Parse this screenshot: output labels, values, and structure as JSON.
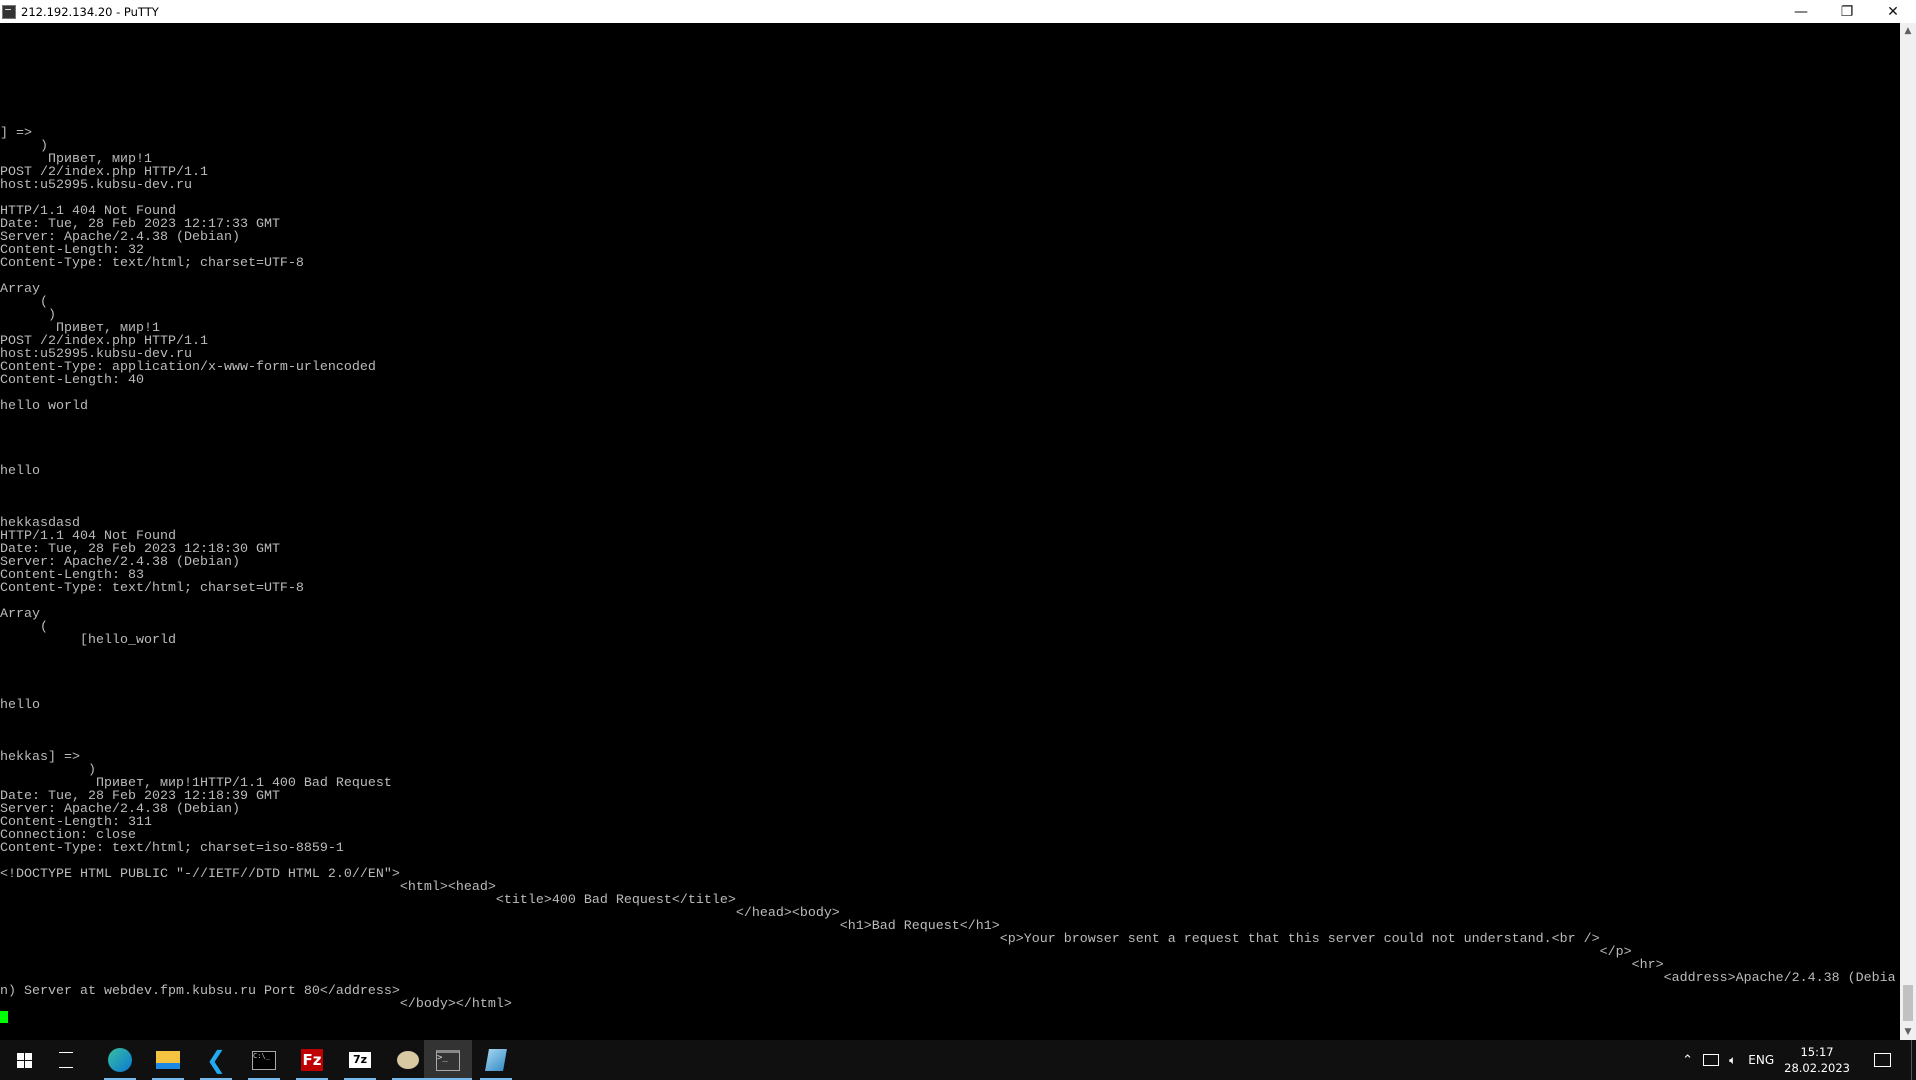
{
  "window": {
    "title": "212.192.134.20 - PuTTY",
    "buttons": {
      "minimize": "—",
      "restore": "❐",
      "close": "✕"
    }
  },
  "terminal": {
    "text_color": "#bbbbbb",
    "cursor_color": "#00ff00",
    "lines": [
      "] =>",
      "     )",
      "      Привет, мир!1",
      "POST /2/index.php HTTP/1.1",
      "host:u52995.kubsu-dev.ru",
      "",
      "HTTP/1.1 404 Not Found",
      "Date: Tue, 28 Feb 2023 12:17:33 GMT",
      "Server: Apache/2.4.38 (Debian)",
      "Content-Length: 32",
      "Content-Type: text/html; charset=UTF-8",
      "",
      "Array",
      "     (",
      "      )",
      "       Привет, мир!1",
      "POST /2/index.php HTTP/1.1",
      "host:u52995.kubsu-dev.ru",
      "Content-Type: application/x-www-form-urlencoded",
      "Content-Length: 40",
      "",
      "hello world",
      "",
      "",
      "",
      "",
      "hello",
      "",
      "",
      "",
      "hekkasdasd",
      "HTTP/1.1 404 Not Found",
      "Date: Tue, 28 Feb 2023 12:18:30 GMT",
      "Server: Apache/2.4.38 (Debian)",
      "Content-Length: 83",
      "Content-Type: text/html; charset=UTF-8",
      "",
      "Array",
      "     (",
      "          [hello_world",
      "",
      "",
      "",
      "",
      "hello",
      "",
      "",
      "",
      "hekkas] =>",
      "           )",
      "            Привет, мир!1HTTP/1.1 400 Bad Request",
      "Date: Tue, 28 Feb 2023 12:18:39 GMT",
      "Server: Apache/2.4.38 (Debian)",
      "Content-Length: 311",
      "Connection: close",
      "Content-Type: text/html; charset=iso-8859-1",
      "",
      "<!DOCTYPE HTML PUBLIC \"-//IETF//DTD HTML 2.0//EN\">",
      "                                                  <html><head>",
      "                                                              <title>400 Bad Request</title>",
      "                                                                                            </head><body>",
      "                                                                                                         <h1>Bad Request</h1>",
      "                                                                                                                             <p>Your browser sent a request that this server could not understand.<br />",
      "                                                                                                                                                                                                        </p>",
      "                                                                                                                                                                                                            <hr>",
      "                                                                                                                                                                                                                <address>Apache/2.4.38 (Debia",
      "n) Server at webdev.fpm.kubsu.ru Port 80</address>",
      "                                                  </body></html>"
    ]
  },
  "taskbar": {
    "apps": [
      {
        "name": "start",
        "icon": "windows-logo-icon",
        "running": false
      },
      {
        "name": "task-view",
        "icon": "task-view-icon",
        "running": false
      },
      {
        "name": "edge",
        "icon": "edge-icon",
        "running": true
      },
      {
        "name": "file-explorer",
        "icon": "folder-icon",
        "running": true
      },
      {
        "name": "vscode",
        "icon": "vscode-icon",
        "running": true
      },
      {
        "name": "command-prompt",
        "icon": "cmd-icon",
        "running": true
      },
      {
        "name": "filezilla",
        "icon": "filezilla-icon",
        "running": true
      },
      {
        "name": "7zip",
        "icon": "7zip-icon",
        "running": true
      },
      {
        "name": "paint",
        "icon": "palette-icon",
        "running": true
      },
      {
        "name": "putty",
        "icon": "putty-terminal-icon",
        "running": true,
        "active": true
      },
      {
        "name": "notepad",
        "icon": "notepad-icon",
        "running": true
      }
    ],
    "tray": {
      "language": "ENG",
      "time": "15:17",
      "date": "28.02.2023"
    }
  }
}
